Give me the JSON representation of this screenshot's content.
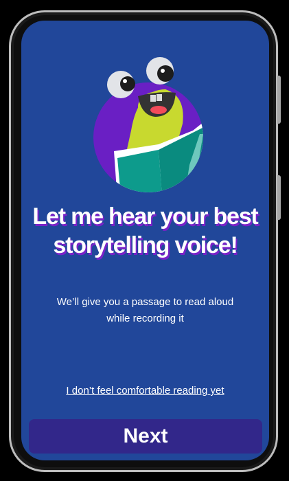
{
  "onboarding": {
    "title": "Let me hear your best storytelling voice!",
    "subtitle": "We’ll give you a passage to read aloud while recording it",
    "skip_link": "I don’t feel comfortable reading yet",
    "next_label": "Next"
  },
  "colors": {
    "background": "#21479a",
    "button": "#32278a",
    "title_shadow": "#7a22c8",
    "mascot_circle": "#6a1fc4"
  }
}
